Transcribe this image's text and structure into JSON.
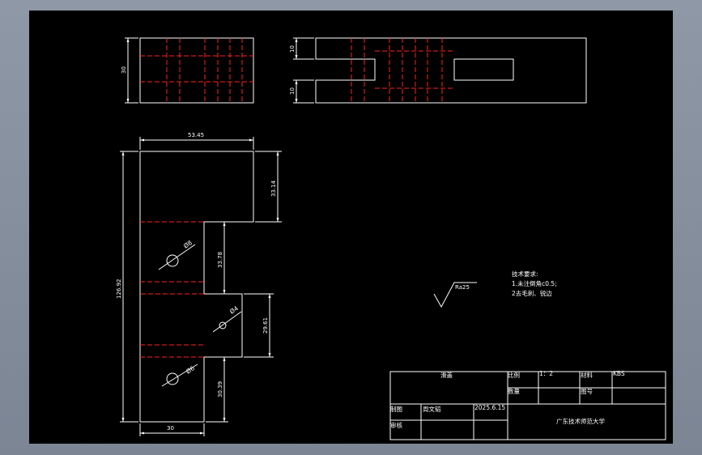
{
  "drawing": {
    "top_view_left": {
      "dim_height": "30"
    },
    "top_view_right": {
      "dim_top": "10",
      "dim_bottom": "10"
    },
    "front_view": {
      "dim_top_width": "53.45",
      "dim_total_height": "126.92",
      "dim_upper_step": "33.14",
      "dim_mid_step": "33.78",
      "dim_lower_step": "29.61",
      "dim_bottom_step": "30.39",
      "dim_bottom_width": "30",
      "hole1": "Ø8",
      "hole2": "Ø4",
      "hole3": "Ø6"
    },
    "roughness": "Ra25",
    "tech_requirements": {
      "title": "技术要求:",
      "line1": "1.未注倒角c0.5;",
      "line2": "2去毛刺、锐边"
    }
  },
  "title_block": {
    "part_name": "滑盖",
    "scale_label": "比例",
    "scale_value": "1：2",
    "material_label": "材料",
    "material_value": "KBS",
    "qty_label": "数量",
    "drawing_no_label": "图号",
    "drawn_label": "制图",
    "drawn_name": "周文韬",
    "date": "2025.6.15",
    "review_label": "审核",
    "school": "广东技术师范大学"
  }
}
